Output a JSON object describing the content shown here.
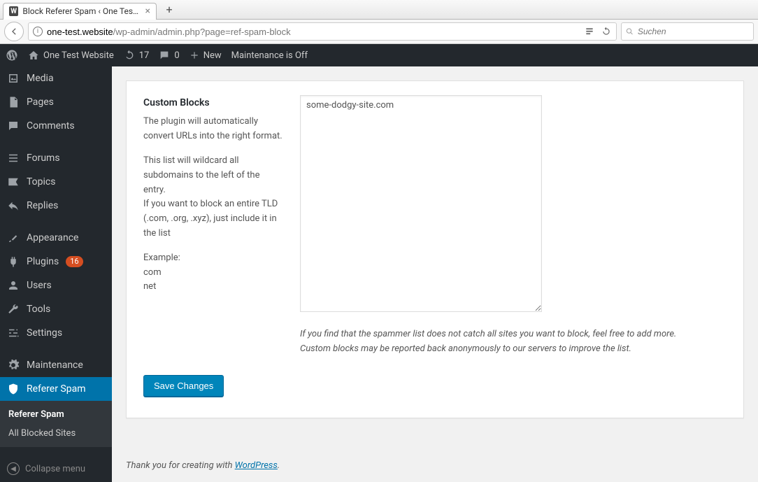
{
  "browser": {
    "tab_title": "Block Referer Spam ‹ One Test W",
    "url_protocol_info": "i",
    "url_host": "one-test.website",
    "url_path": "/wp-admin/admin.php?page=ref-spam-block",
    "search_placeholder": "Suchen"
  },
  "adminbar": {
    "site_name": "One Test Website",
    "updates_count": "17",
    "comments_count": "0",
    "new_label": "New",
    "maintenance_label": "Maintenance is Off"
  },
  "sidebar": {
    "items": [
      {
        "label": "Media"
      },
      {
        "label": "Pages"
      },
      {
        "label": "Comments"
      },
      {
        "label": "Forums"
      },
      {
        "label": "Topics"
      },
      {
        "label": "Replies"
      },
      {
        "label": "Appearance"
      },
      {
        "label": "Plugins",
        "badge": "16"
      },
      {
        "label": "Users"
      },
      {
        "label": "Tools"
      },
      {
        "label": "Settings"
      },
      {
        "label": "Maintenance"
      },
      {
        "label": "Referer Spam"
      }
    ],
    "submenu": [
      {
        "label": "Referer Spam"
      },
      {
        "label": "All Blocked Sites"
      }
    ],
    "collapse_label": "Collapse menu"
  },
  "content": {
    "heading": "Custom Blocks",
    "desc1": "The plugin will automatically convert URLs into the right format.",
    "desc2": "This list will wildcard all subdomains to the left of the entry.",
    "desc3": "If you want to block an entire TLD (.com, .org, .xyz), just include it in the list",
    "example_label": "Example:",
    "example_line1": "com",
    "example_line2": "net",
    "textarea_value": "some-dodgy-site.com",
    "help_line1": "If you find that the spammer list does not catch all sites you want to block, feel free to add more.",
    "help_line2": "Custom blocks may be reported back anonymously to our servers to improve the list.",
    "save_label": "Save Changes"
  },
  "footer": {
    "prefix": "Thank you for creating with ",
    "link": "WordPress",
    "suffix": "."
  }
}
